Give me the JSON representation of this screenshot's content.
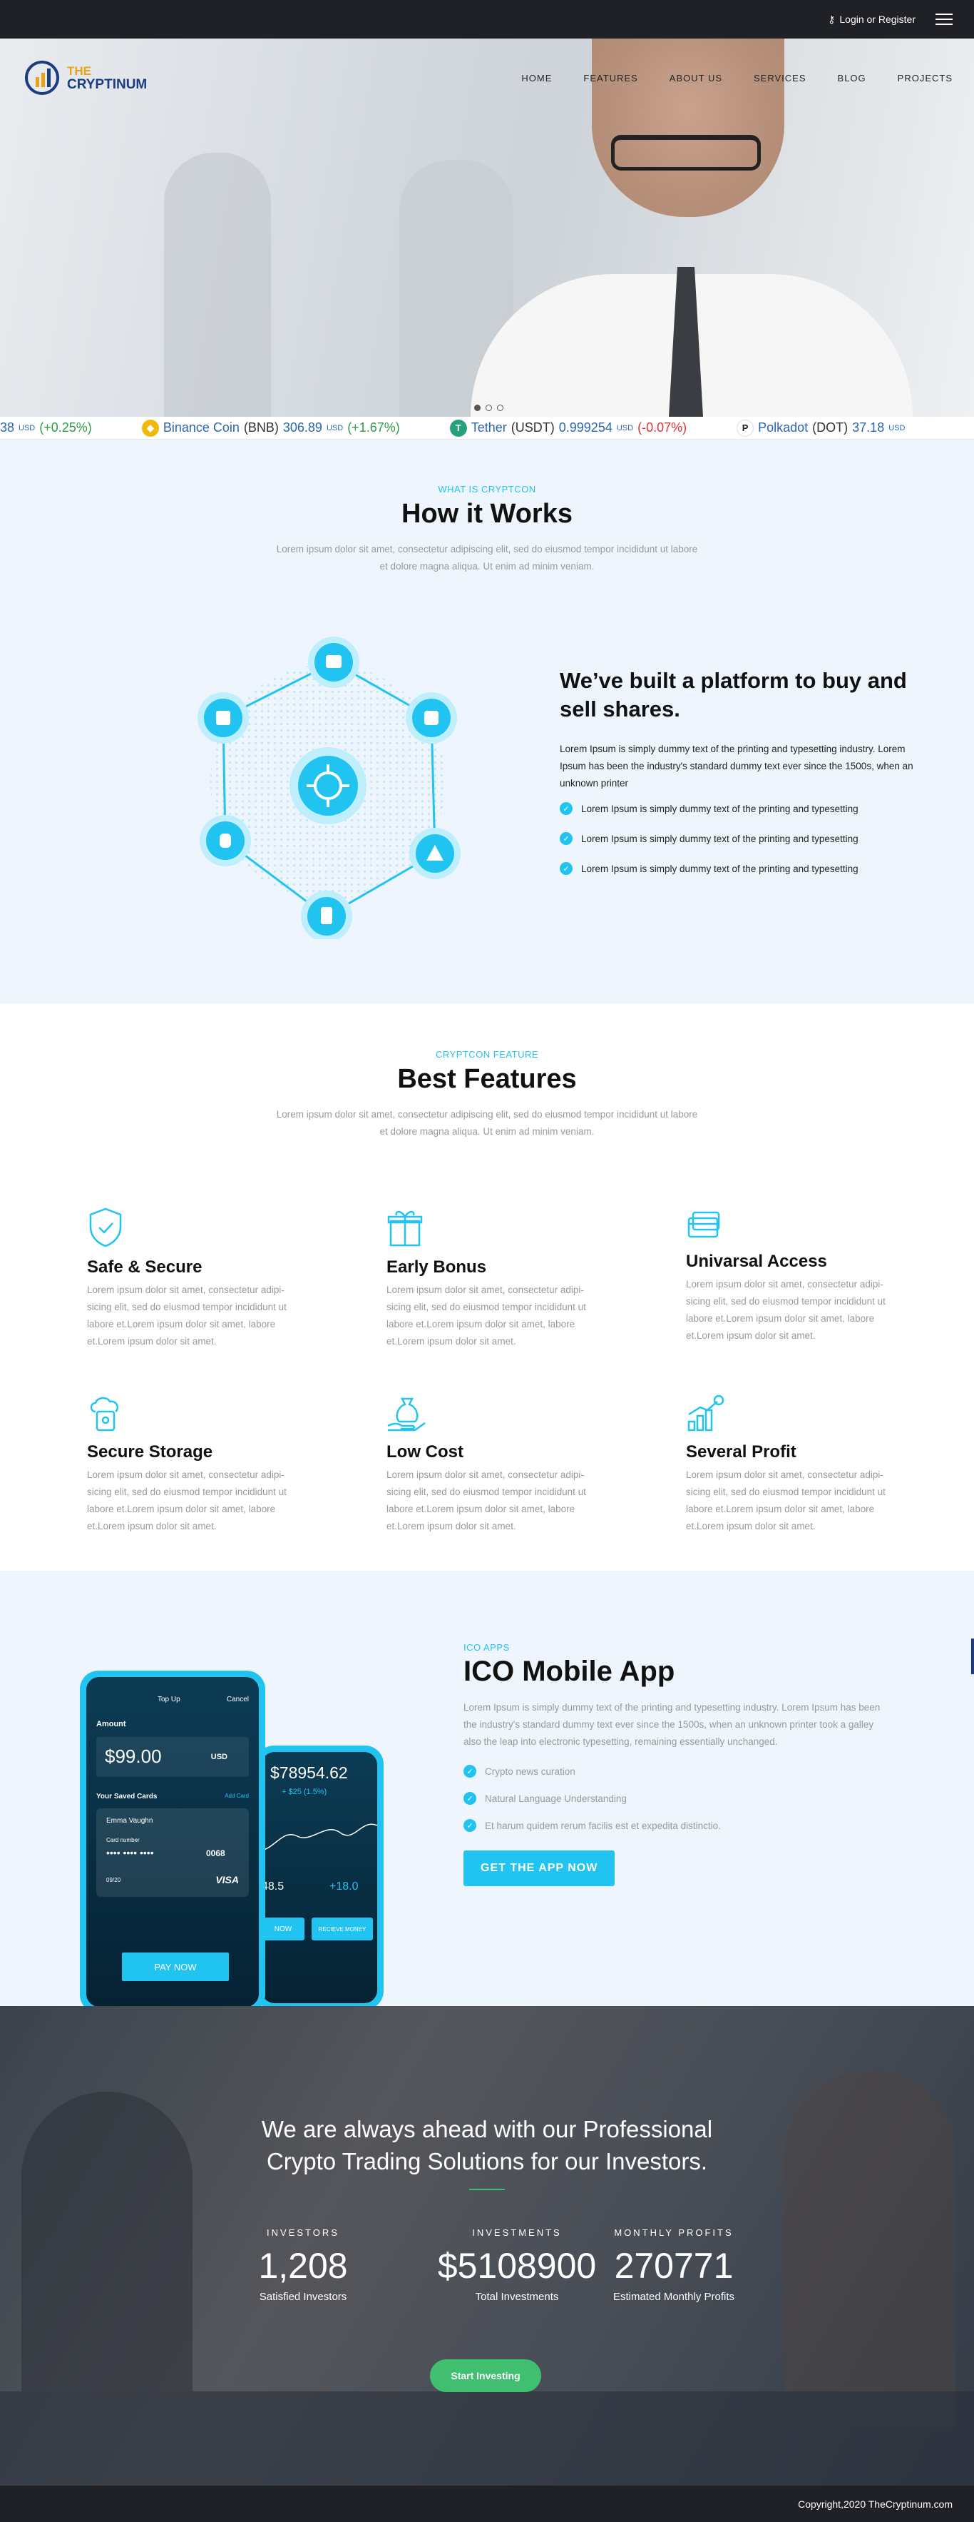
{
  "topbar": {
    "login_label": "Login or Register"
  },
  "nav": {
    "logo_line1": "THE",
    "logo_line2": "CRYPTINUM",
    "items": [
      "HOME",
      "FEATURES",
      "ABOUT US",
      "SERVICES",
      "BLOG",
      "PROJECTS"
    ]
  },
  "ticker": [
    {
      "name": "",
      "symbol": "",
      "price": "38",
      "change": "(+0.25%)",
      "dir": "up",
      "icon": "",
      "color": ""
    },
    {
      "name": "Binance Coin",
      "symbol": "(BNB)",
      "price": "306.89",
      "change": "(+1.67%)",
      "dir": "up",
      "icon": "bnb-icon",
      "color": "#f0b90b"
    },
    {
      "name": "Tether",
      "symbol": "(USDT)",
      "price": "0.999254",
      "change": "(-0.07%)",
      "dir": "dn",
      "icon": "tether-icon",
      "color": "#26a17b"
    },
    {
      "name": "Polkadot",
      "symbol": "(DOT)",
      "price": "37.18",
      "change": "",
      "dir": "up",
      "icon": "polkadot-icon",
      "color": "#222"
    }
  ],
  "ticker_unit": "USD",
  "works": {
    "subtitle": "WHAT IS CRYPTCON",
    "title": "How it Works",
    "lead": "Lorem ipsum dolor sit amet, consectetur adipiscing elit, sed do eiusmod tempor incididunt ut labore et dolore magna aliqua. Ut enim ad minim veniam.",
    "heading": "We’ve built a platform to buy and sell shares.",
    "text": "Lorem Ipsum is simply dummy text of the printing and typesetting industry. Lorem Ipsum has been the industry's standard dummy text ever since the 1500s, when an unknown printer",
    "checks": [
      "Lorem Ipsum is simply dummy text of the printing and typesetting",
      "Lorem Ipsum is simply dummy text of the printing and typesetting",
      "Lorem Ipsum is simply dummy text of the printing and typesetting"
    ]
  },
  "features": {
    "subtitle": "CRYPTCON FEATURE",
    "title": "Best Features",
    "lead": "Lorem ipsum dolor sit amet, consectetur adipiscing elit, sed do eiusmod tempor incididunt ut labore et dolore magna aliqua. Ut enim ad minim veniam.",
    "items": [
      {
        "title": "Safe & Secure",
        "icon": "shield-icon"
      },
      {
        "title": "Early Bonus",
        "icon": "gift-icon"
      },
      {
        "title": "Univarsal Access",
        "icon": "card-icon"
      },
      {
        "title": "Secure Storage",
        "icon": "cloud-lock-icon"
      },
      {
        "title": "Low Cost",
        "icon": "money-bag-icon"
      },
      {
        "title": "Several Profit",
        "icon": "growth-chart-icon"
      }
    ],
    "desc": "Lorem ipsum dolor sit amet, consectetur adipi-sicing elit, sed do eiusmod tempor incididunt ut labore et.Lorem ipsum dolor sit amet, labore et.Lorem ipsum dolor sit amet."
  },
  "app": {
    "subtitle": "ICO APPS",
    "title": "ICO Mobile App",
    "text": "Lorem Ipsum is simply dummy text of the printing and typesetting industry. Lorem Ipsum has been the industry's standard dummy text ever since the 1500s, when an unknown printer took a galley also the leap into electronic typesetting, remaining essentially unchanged.",
    "list": [
      "Crypto news curation",
      "Natural Language Understanding",
      "Et harum quidem rerum facilis est et expedita distinctio."
    ],
    "button": "GET THE APP NOW",
    "phone1": {
      "header": "Top Up",
      "cancel": "Cancel",
      "amount_label": "Amount",
      "amount": "99.00",
      "currency": "USD",
      "saved": "Your Saved Cards",
      "add": "Add Card",
      "holder": "Emma Vaughn",
      "card_label": "Card number",
      "card_dots": "•••• •••• ••••",
      "last4": "0068",
      "expiry": "09/20",
      "brand": "VISA",
      "pay": "PAY NOW"
    },
    "phone2": {
      "balance": "78954.62",
      "delta": "+ $25 (1.5%)",
      "v1": "48.5",
      "v2": "+18.0",
      "b1": "NOW",
      "b2": "RECIEVE MONEY"
    }
  },
  "stats": {
    "heading": "We are always ahead with our Professional Crypto Trading Solutions for our Investors.",
    "cols": [
      {
        "label": "INVESTORS",
        "value": "1,208",
        "caption": "Satisfied Investors"
      },
      {
        "label": "INVESTMENTS",
        "value": "$5108900",
        "caption": "Total Investments"
      },
      {
        "label": "MONTHLY PROFITS",
        "value": "270771",
        "caption": "Estimated Monthly Profits"
      }
    ],
    "button": "Start Investing"
  },
  "footer": {
    "copyright": "Copyright,2020  TheCryptinum.com"
  }
}
